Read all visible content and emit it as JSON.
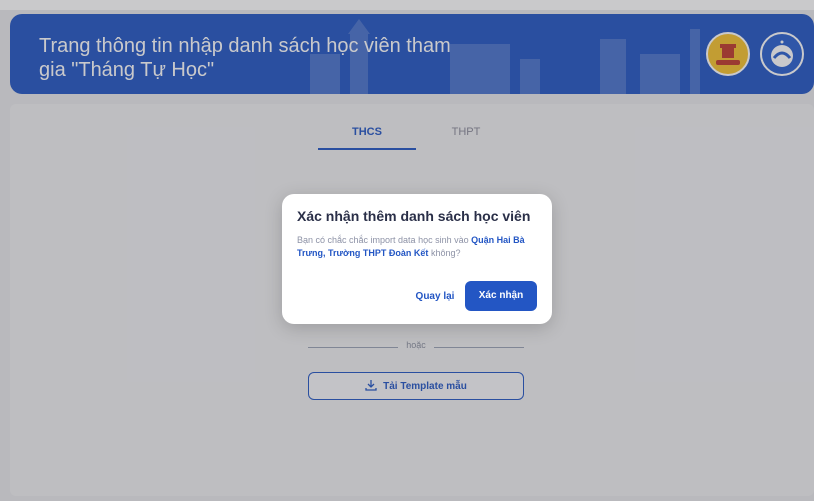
{
  "header": {
    "title": "Trang thông tin nhập danh sách học viên tham gia \"Tháng Tự Học\""
  },
  "tabs": [
    {
      "label": "THCS",
      "active": true
    },
    {
      "label": "THPT",
      "active": false
    }
  ],
  "divider": {
    "label": "hoặc"
  },
  "template_button": {
    "label": "Tải Template mẫu",
    "icon": "download-icon"
  },
  "dialog": {
    "title": "Xác nhận thêm danh sách học viên",
    "message_prefix": "Bạn có chắc chắc import data học sinh vào ",
    "message_highlight": "Quận Hai Bà Trưng, Trường THPT Đoàn Kết",
    "message_suffix": " không?",
    "cancel_label": "Quay lại",
    "confirm_label": "Xác nhận"
  },
  "colors": {
    "primary": "#2356c4",
    "header_bg": "#2356c4",
    "logo_gold": "#f5c22d"
  }
}
